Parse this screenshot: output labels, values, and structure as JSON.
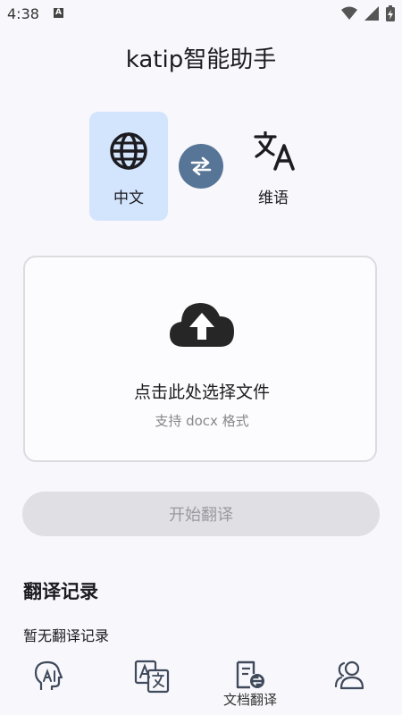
{
  "status_bar": {
    "time": "4:38",
    "notification_letter": "A"
  },
  "app": {
    "title": "katip智能助手"
  },
  "languages": {
    "source": {
      "label": "中文",
      "icon": "globe-icon",
      "selected": true
    },
    "target": {
      "label": "维语",
      "icon": "translate-icon"
    }
  },
  "upload": {
    "icon": "cloud-upload-icon",
    "prompt": "点击此处选择文件",
    "hint": "支持 docx 格式"
  },
  "actions": {
    "start_label": "开始翻译"
  },
  "history": {
    "title": "翻译记录",
    "empty_text": "暂无翻译记录"
  },
  "bottom_nav": {
    "items": [
      {
        "icon": "ai-head-icon",
        "label": ""
      },
      {
        "icon": "text-translate-icon",
        "label": ""
      },
      {
        "icon": "document-translate-icon",
        "label": "文档翻译",
        "active": true
      },
      {
        "icon": "users-icon",
        "label": ""
      }
    ]
  },
  "colors": {
    "selected_card": "#d3e4fd",
    "swap_button": "#577597",
    "disabled_button": "#e0dfe4",
    "background": "#f8f7fb"
  }
}
